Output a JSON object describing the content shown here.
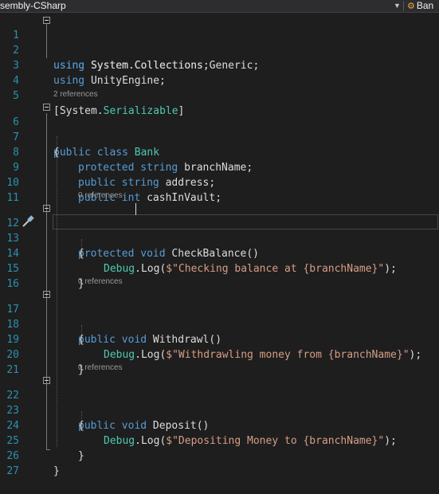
{
  "toolbar": {
    "project_label": "sembly-CSharp",
    "class_dropdown_label": "Ban"
  },
  "editor": {
    "lines": [
      {
        "num": "1"
      },
      {
        "num": "2"
      },
      {
        "num": "3"
      },
      {
        "num": "4"
      },
      {
        "num": "5"
      },
      {
        "num": "6"
      },
      {
        "num": "7"
      },
      {
        "num": "8"
      },
      {
        "num": "9"
      },
      {
        "num": "10"
      },
      {
        "num": "11"
      },
      {
        "num": "12"
      },
      {
        "num": "13"
      },
      {
        "num": "14"
      },
      {
        "num": "15"
      },
      {
        "num": "16"
      },
      {
        "num": "17"
      },
      {
        "num": "18"
      },
      {
        "num": "19"
      },
      {
        "num": "20"
      },
      {
        "num": "21"
      },
      {
        "num": "22"
      },
      {
        "num": "23"
      },
      {
        "num": "24"
      },
      {
        "num": "25"
      },
      {
        "num": "26"
      },
      {
        "num": "27"
      }
    ],
    "codelens": {
      "bank_refs": "2 references",
      "checkbalance_refs": "0 references",
      "withdrawl_refs": "0 references",
      "deposit_refs": "0 references"
    },
    "tokens": {
      "using": "using",
      "ns_collections": " System.Collections;",
      "ns_generic": " System.Collections.Generic;",
      "ns_unity": " UnityEngine;",
      "attr_open": "[System.",
      "attr_name": "Serializable",
      "attr_close": "]",
      "public": "public",
      "class": "class",
      "class_name": "Bank",
      "open_brace": "{",
      "close_brace": "}",
      "protected": "protected",
      "string": "string",
      "int": "int",
      "void": "void",
      "branch_field": " branchName;",
      "address_field": " address;",
      "cash_field": " cashInVault;",
      "checkbalance_sig": " CheckBalance()",
      "withdrawl_sig": " Withdrawl()",
      "deposit_sig": " Deposit()",
      "debug": "Debug",
      "log_open": ".Log(",
      "log_close": ");",
      "str_checking": "$\"Checking balance at {branchName}\"",
      "str_withdrawling": "$\"Withdrawling money from {branchName}\"",
      "str_depositing": "$\"Depositing Money to {branchName}\""
    }
  },
  "colors": {
    "background": "#1e1e1e",
    "keyword": "#569cd6",
    "type": "#4ec9b0",
    "string": "#d69d85",
    "line_number": "#2b91af"
  },
  "icons": {
    "quick_action": "screwdriver-brush-icon",
    "class_combo": "class-icon",
    "fold": "collapse-minus-icon"
  }
}
